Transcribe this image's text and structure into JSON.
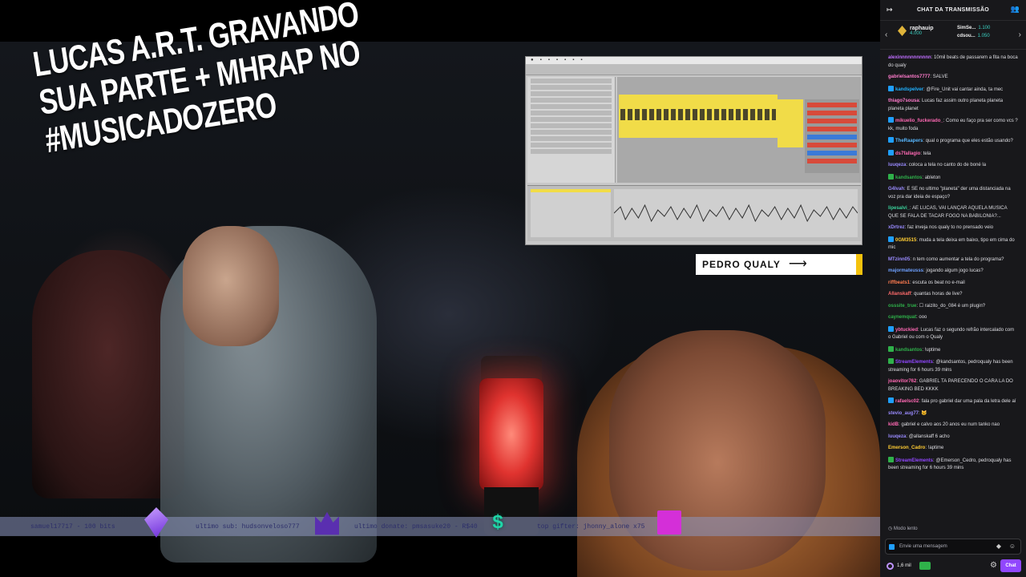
{
  "overlay": {
    "title_lines": [
      "LUCAS A.R.T. GRAVANDO",
      "SUA PARTE + MHRAP NO",
      "#MUSICADOZERO"
    ],
    "name_tag": "PEDRO QUALY"
  },
  "ticker": {
    "item1": "samuel17717 - 100 bits",
    "item2": "ultimo sub: hudsonveloso777",
    "item3": "ultimo donate: pmsasuke20 - R$40",
    "item4": "top gifter: jhonny_alone x75"
  },
  "chat": {
    "header_title": "CHAT DA TRANSMISSÃO",
    "leaderboard": {
      "first_name": "raphauip",
      "first_points": "4.000",
      "second_name": "SimSe...",
      "second_points": "1.100",
      "third_name": "cdsou...",
      "third_points": "1.050"
    },
    "messages": [
      {
        "user": "alexinnnnnnnnnnn",
        "color": "#c06eff",
        "text": "10mil beats de passarem a fita na boca do qualy",
        "badge": ""
      },
      {
        "user": "gabrielsantos7777",
        "color": "#ff7bcc",
        "text": "SALVE",
        "badge": ""
      },
      {
        "user": "kandspelver",
        "color": "#1fb1ff",
        "text": "@Fire_Unit vai cantar ainda, ta mec",
        "badge": "b-blue"
      },
      {
        "user": "thiago7sousa",
        "color": "#ff7bcc",
        "text": "Lucas faz assim outro planeta planeta planeta planet",
        "badge": ""
      },
      {
        "user": "mikuelio_fuckerado_",
        "color": "#ff69b4",
        "text": "Como eu faço pra ser como vcs ? kk, muito foda",
        "badge": "b-blue"
      },
      {
        "user": "TheRaapers",
        "color": "#58b8ff",
        "text": "qual o programa que eles estão usando?",
        "badge": "b-blue"
      },
      {
        "user": "ds7fallagio",
        "color": "#ff69b4",
        "text": "tela",
        "badge": "b-blue"
      },
      {
        "user": "luuqeza",
        "color": "#9a8bff",
        "text": "coloca a tela no canto do de boné la",
        "badge": ""
      },
      {
        "user": "kandsantos",
        "color": "#2fb14a",
        "text": "ableton",
        "badge": "b-green"
      },
      {
        "user": "G4lvah",
        "color": "#9a8bff",
        "text": "E SE no ultimo \"planeta\" der uma distanciada na voz pra dar ideia de espaço?",
        "badge": ""
      },
      {
        "user": "lipesalvi_",
        "color": "#3ad19a",
        "text": "AE LUCAS, VAI LANÇAR AQUELA MUSICA QUE SE FALA DE TACAR FOGO NA BABILONIA?...",
        "badge": ""
      },
      {
        "user": "xDrtrez",
        "color": "#9a8bff",
        "text": "faz inveja nos qualy to no prensado veio",
        "badge": ""
      },
      {
        "user": "0GM3515",
        "color": "#ffcc33",
        "text": "muda a tela deixa em baixo, tipo em cima do mic",
        "badge": "b-blue"
      },
      {
        "user": "MTzinn05",
        "color": "#9a8bff",
        "text": "n tem como aumentar a tela do programa?",
        "badge": ""
      },
      {
        "user": "majormateusss",
        "color": "#6ea0ff",
        "text": "jogando algum jogo lucas?",
        "badge": ""
      },
      {
        "user": "riffbeats1",
        "color": "#ff7b50",
        "text": "escuta os beat no e-mail",
        "badge": ""
      },
      {
        "user": "Allanskaff",
        "color": "#ff6b6b",
        "text": "quantas horas de live?",
        "badge": ""
      },
      {
        "user": "osssite_true",
        "color": "#2fb14a",
        "text": "☐ raizito_do_084 é um plugin?",
        "badge": ""
      },
      {
        "user": "caynemquat",
        "color": "#2fb14a",
        "text": "ooo",
        "badge": ""
      },
      {
        "user": "ybtuckied",
        "color": "#ff69b4",
        "text": "Lucas faz o segundo refrão intercalado com o Gabriel ou com o Qualy",
        "badge": "b-blue"
      },
      {
        "user": "kandsantos",
        "color": "#2fb14a",
        "text": "!uptime",
        "badge": "b-green"
      },
      {
        "user": "StreamElements",
        "color": "#9147ff",
        "text": "@kandsantos, pedroqualy has been streaming for 6 hours 39 mins",
        "badge": "b-green"
      },
      {
        "user": "joaovitor762",
        "color": "#ff69b4",
        "text": "GABRIEL TA PARECENDO O CARA LA DO BREAKING BED KKKK",
        "badge": ""
      },
      {
        "user": "rafaelsc02",
        "color": "#ff69b4",
        "text": "fala pro gabriel dar uma pala da letra dele aí",
        "badge": "b-blue"
      },
      {
        "user": "stevio_aug77",
        "color": "#9a8bff",
        "text": "🐱",
        "badge": ""
      },
      {
        "user": "kidB",
        "color": "#ff69b4",
        "text": "gabriel e calvo aos 20 anos eu num tanko nao",
        "badge": ""
      },
      {
        "user": "luuqeza",
        "color": "#9a8bff",
        "text": "@allanskaff 6 acho",
        "badge": ""
      },
      {
        "user": "Emerson_Cadro",
        "color": "#ffcc33",
        "text": "!aptime",
        "badge": ""
      },
      {
        "user": "StreamElements",
        "color": "#9147ff",
        "text": "@Emerson_Cedro, pedroqualy has been streaming for 6 hours 39 mins",
        "badge": "b-green"
      }
    ],
    "mode_text": "Modo lento",
    "input_placeholder": "Envie uma mensagem",
    "points": "1,6 mil",
    "send_label": "Chat"
  }
}
